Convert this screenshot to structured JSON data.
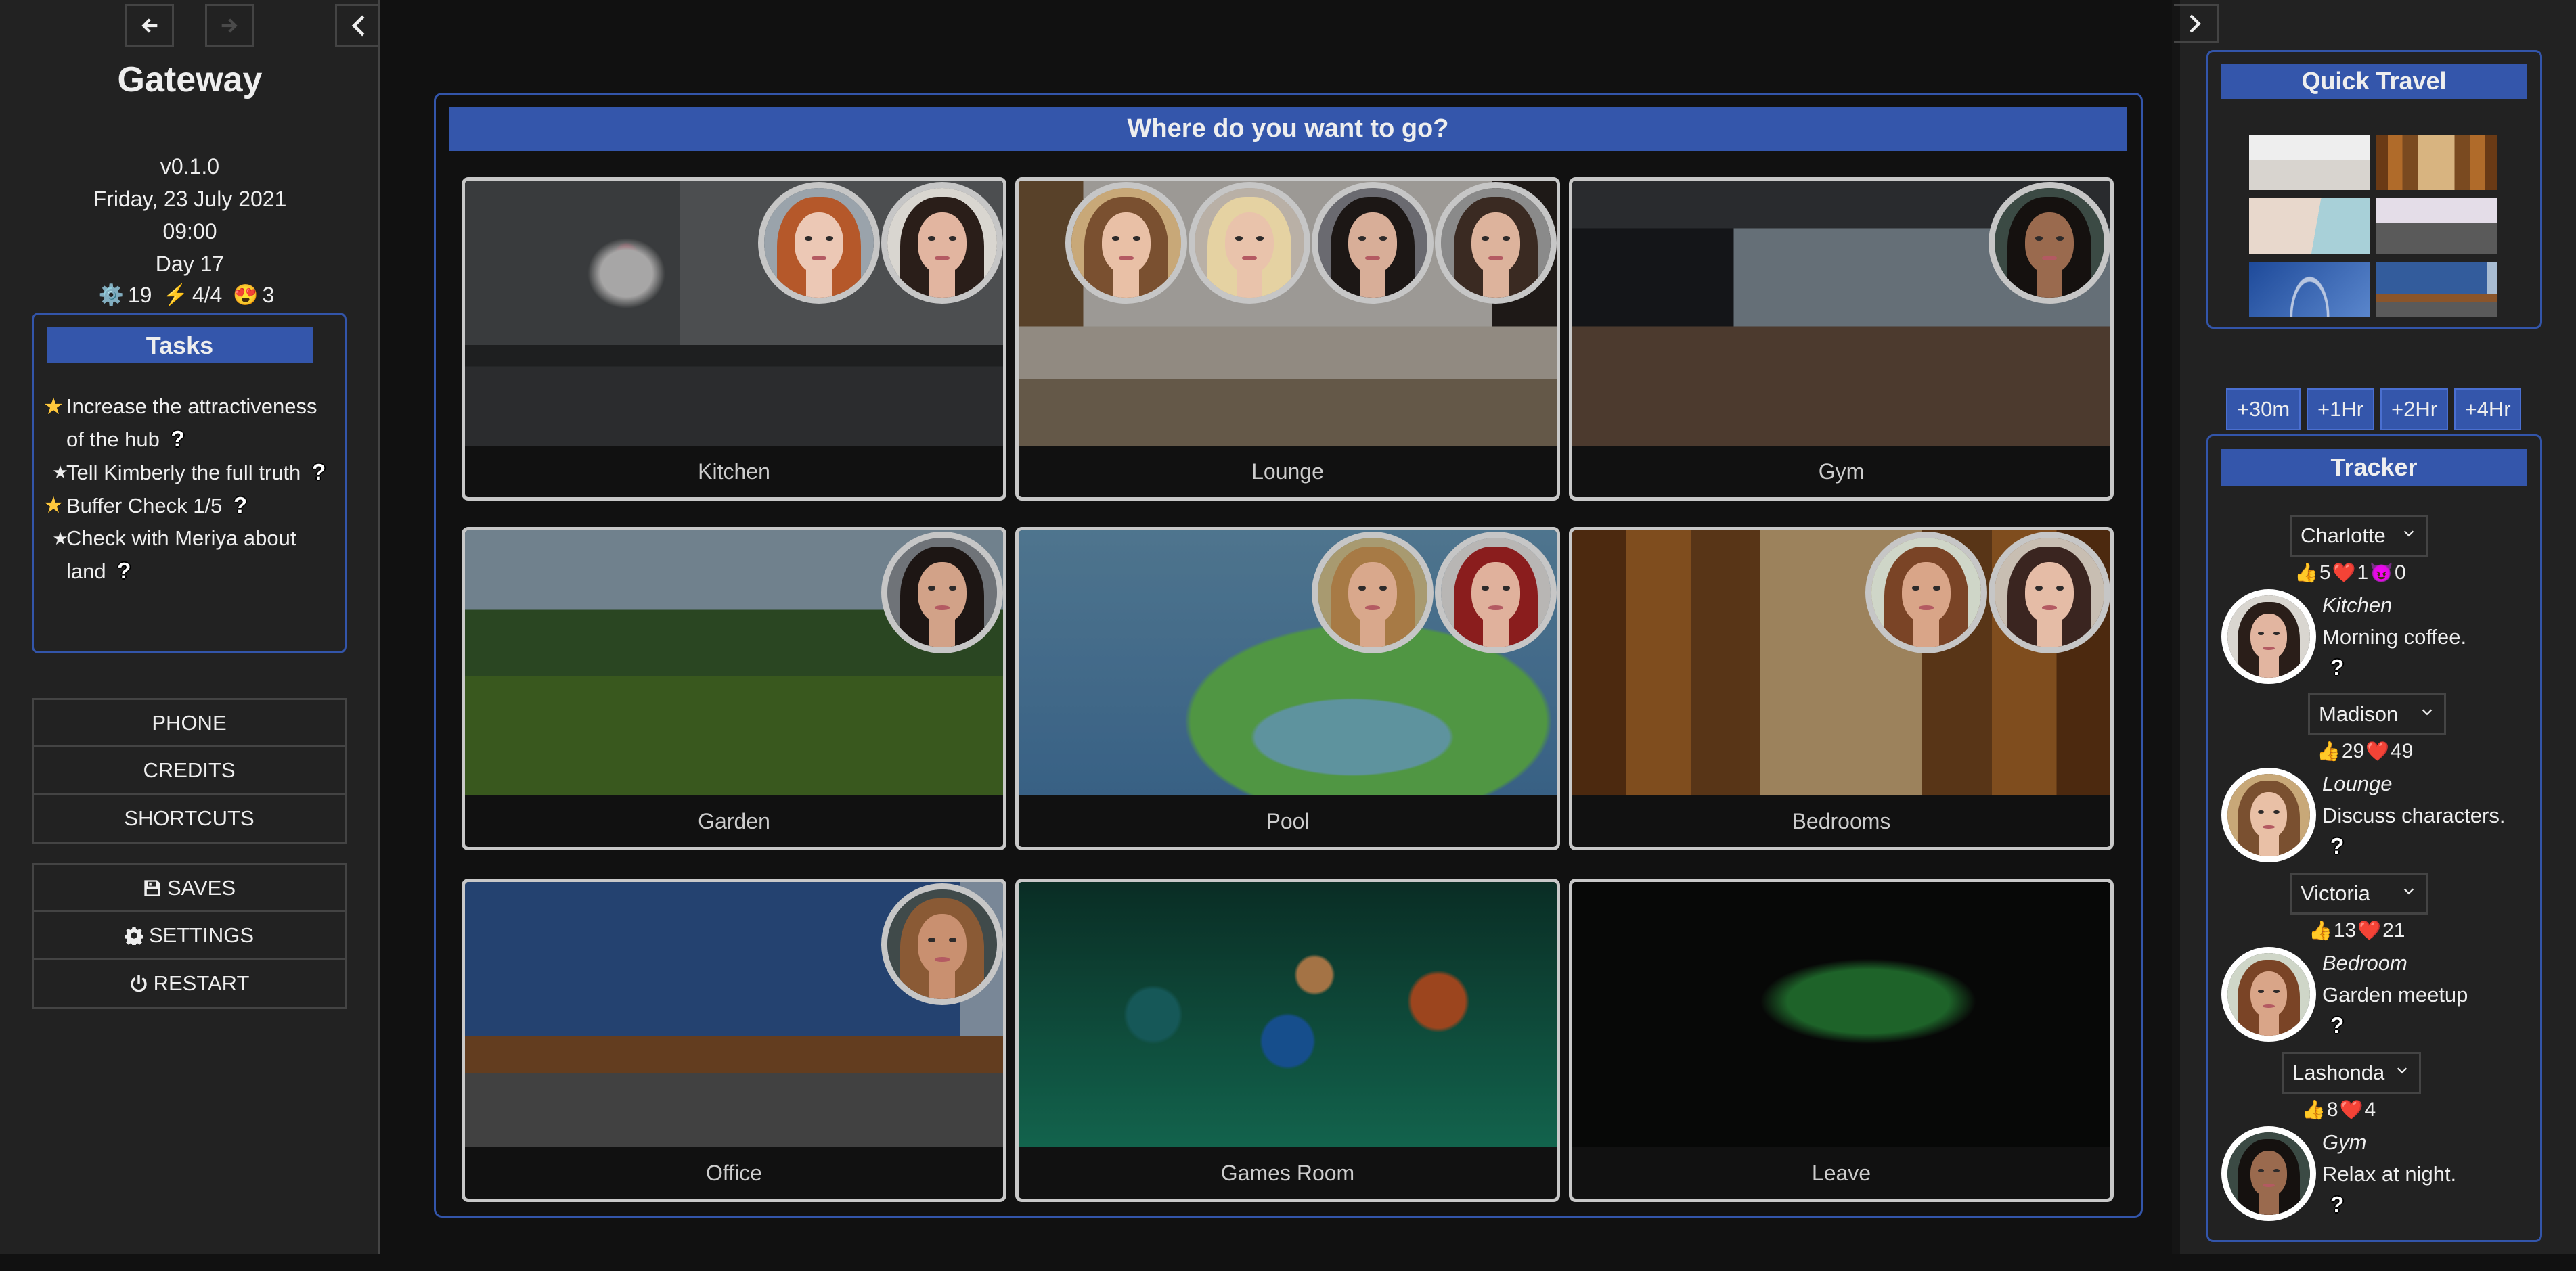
{
  "nav": {
    "back_icon": "arrow-left-icon",
    "forward_icon": "arrow-right-icon",
    "forward_disabled": true,
    "collapse_left_icon": "chevron-left-icon",
    "collapse_right_icon": "chevron-right-icon"
  },
  "story": {
    "title": "Gateway",
    "version": "v0.1.0",
    "date": "Friday, 23 July 2021",
    "time": "09:00",
    "day": "Day 17",
    "stats": [
      {
        "icon": "gear-icon",
        "glyph": "⚙️",
        "value": "19"
      },
      {
        "icon": "lightning-icon",
        "glyph": "⚡",
        "value": "4/4"
      },
      {
        "icon": "heart-eyes-icon",
        "glyph": "😍",
        "value": "3"
      }
    ]
  },
  "tasks": {
    "title": "Tasks",
    "items": [
      {
        "star": "gold",
        "text": "Increase the attractiveness of the hub",
        "help": "?"
      },
      {
        "star": "plain",
        "text": "Tell Kimberly the full truth",
        "help": "?"
      },
      {
        "star": "gold",
        "text": "Buffer Check 1/5",
        "help": "?"
      },
      {
        "star": "plain",
        "text": "Check with Meriya about land",
        "help": "?"
      }
    ]
  },
  "menu": {
    "group1": [
      "PHONE",
      "CREDITS",
      "SHORTCUTS"
    ],
    "group2": [
      {
        "label": "SAVES",
        "icon": "floppy-disk-icon"
      },
      {
        "label": "SETTINGS",
        "icon": "gear-icon"
      },
      {
        "label": "RESTART",
        "icon": "power-icon"
      }
    ]
  },
  "main": {
    "heading": "Where do you want to go?",
    "locations": [
      {
        "label": "Kitchen",
        "scene": "kitchen",
        "avatars": [
          "f1",
          "f2"
        ]
      },
      {
        "label": "Lounge",
        "scene": "lounge",
        "avatars": [
          "f3",
          "f4",
          "f5",
          "f6"
        ]
      },
      {
        "label": "Gym",
        "scene": "gym",
        "avatars": [
          "f7"
        ]
      },
      {
        "label": "Garden",
        "scene": "garden",
        "avatars": [
          "f8"
        ]
      },
      {
        "label": "Pool",
        "scene": "pool",
        "avatars": [
          "f9",
          "f10"
        ]
      },
      {
        "label": "Bedrooms",
        "scene": "bedrooms",
        "avatars": [
          "f11",
          "f12"
        ]
      },
      {
        "label": "Office",
        "scene": "office",
        "avatars": [
          "f13"
        ]
      },
      {
        "label": "Games Room",
        "scene": "games",
        "avatars": []
      },
      {
        "label": "Leave",
        "scene": "exit",
        "avatars": []
      }
    ]
  },
  "quick_travel": {
    "title": "Quick Travel",
    "thumbnails": [
      {
        "scene": "bedroom-white",
        "name": "bedroom"
      },
      {
        "scene": "bedrooms",
        "name": "bedrooms-hallway"
      },
      {
        "scene": "building",
        "name": "building-palms"
      },
      {
        "scene": "alley",
        "name": "alley"
      },
      {
        "scene": "arch",
        "name": "arch"
      },
      {
        "scene": "office",
        "name": "office"
      }
    ]
  },
  "time_buttons": [
    "+30m",
    "+1Hr",
    "+2Hr",
    "+4Hr"
  ],
  "tracker": {
    "title": "Tracker",
    "entries": [
      {
        "name": "Charlotte",
        "avatar": "f1",
        "location": "Kitchen",
        "activity": "Morning coffee.",
        "stats": [
          {
            "icon": "thumbs-up-icon",
            "glyph": "👍",
            "value": "5"
          },
          {
            "icon": "heart-icon",
            "glyph": "❤️",
            "value": "1"
          },
          {
            "icon": "devil-icon",
            "glyph": "😈",
            "value": "0"
          }
        ]
      },
      {
        "name": "Madison",
        "avatar": "f6",
        "location": "Lounge",
        "activity": "Discuss characters.",
        "stats": [
          {
            "icon": "thumbs-up-icon",
            "glyph": "👍",
            "value": "29"
          },
          {
            "icon": "heart-icon",
            "glyph": "❤️",
            "value": "49"
          }
        ]
      },
      {
        "name": "Victoria",
        "avatar": "f12",
        "location": "Bedroom",
        "activity": "Garden meetup",
        "stats": [
          {
            "icon": "thumbs-up-icon",
            "glyph": "👍",
            "value": "13"
          },
          {
            "icon": "heart-icon",
            "glyph": "❤️",
            "value": "21"
          }
        ]
      },
      {
        "name": "Lashonda",
        "avatar": "f7",
        "location": "Gym",
        "activity": "Relax at night.",
        "stats": [
          {
            "icon": "thumbs-up-icon",
            "glyph": "👍",
            "value": "8"
          },
          {
            "icon": "heart-icon",
            "glyph": "❤️",
            "value": "4"
          }
        ]
      }
    ]
  },
  "colors": {
    "accent_blue": "#3456ab",
    "border_blue": "#3355aa",
    "sidebar_bg": "#222222",
    "page_bg": "#111111",
    "tile_border": "#c8c8c8",
    "star_gold": "#ffc83d"
  }
}
